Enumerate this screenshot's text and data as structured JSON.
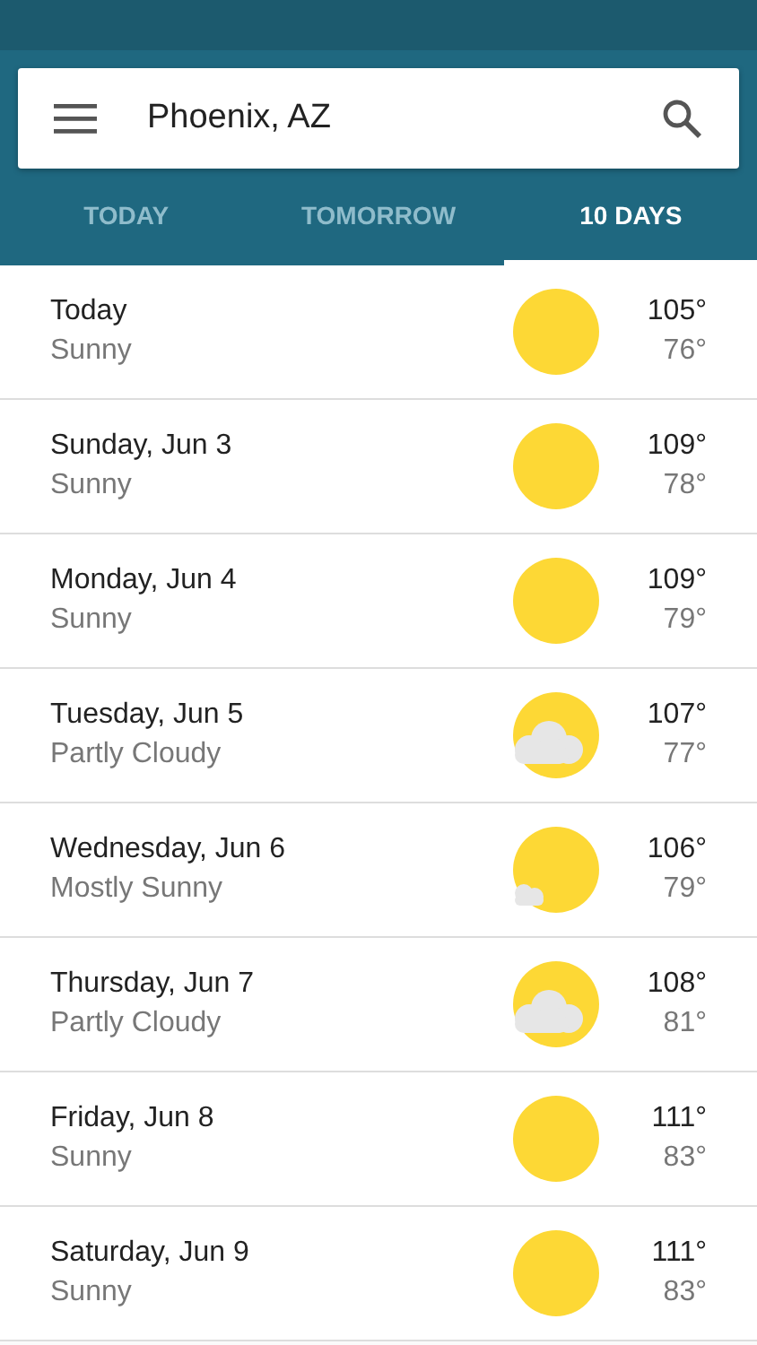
{
  "search": {
    "value": "Phoenix, AZ"
  },
  "tabs": [
    {
      "label": "TODAY",
      "selected": false
    },
    {
      "label": "TOMORROW",
      "selected": false
    },
    {
      "label": "10 DAYS",
      "selected": true
    }
  ],
  "days": [
    {
      "day": "Today",
      "condition": "Sunny",
      "kind": "sunny",
      "high": "105°",
      "low": "76°"
    },
    {
      "day": "Sunday, Jun 3",
      "condition": "Sunny",
      "kind": "sunny",
      "high": "109°",
      "low": "78°"
    },
    {
      "day": "Monday, Jun 4",
      "condition": "Sunny",
      "kind": "sunny",
      "high": "109°",
      "low": "79°"
    },
    {
      "day": "Tuesday, Jun 5",
      "condition": "Partly Cloudy",
      "kind": "cloudy",
      "high": "107°",
      "low": "77°"
    },
    {
      "day": "Wednesday, Jun 6",
      "condition": "Mostly Sunny",
      "kind": "mostly",
      "high": "106°",
      "low": "79°"
    },
    {
      "day": "Thursday, Jun 7",
      "condition": "Partly Cloudy",
      "kind": "cloudy",
      "high": "108°",
      "low": "81°"
    },
    {
      "day": "Friday, Jun 8",
      "condition": "Sunny",
      "kind": "sunny",
      "high": "111°",
      "low": "83°"
    },
    {
      "day": "Saturday, Jun 9",
      "condition": "Sunny",
      "kind": "sunny",
      "high": "111°",
      "low": "83°"
    }
  ]
}
